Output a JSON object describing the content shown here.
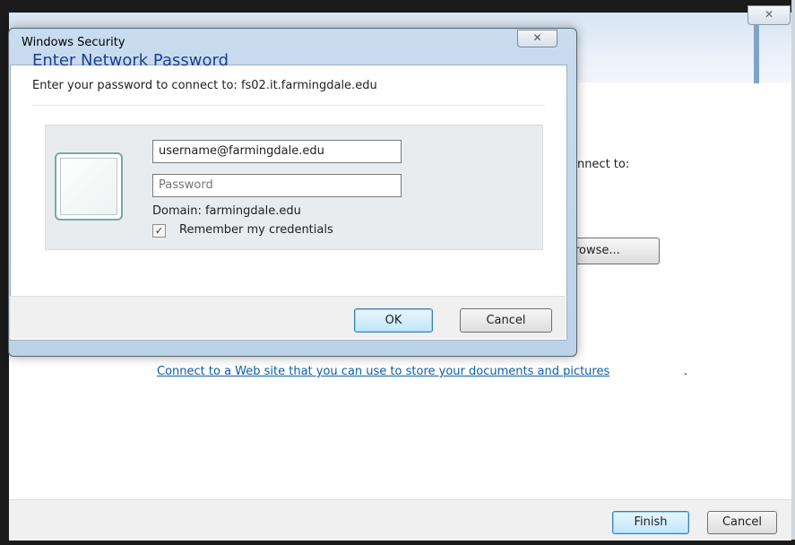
{
  "background_window": {
    "close_glyph": "✕",
    "connect_text": "onnect to:",
    "browse_label": "Browse...",
    "browse_visible": "rowse...",
    "link_text": "Connect to a Web site that you can use to store your documents and pictures",
    "link_period": ".",
    "finish_label": "Finish",
    "cancel_label": "Cancel"
  },
  "dialog": {
    "title": "Windows Security",
    "close_glyph": "✕",
    "heading": "Enter Network Password",
    "subtitle": "Enter your password to connect to: fs02.it.farmingdale.edu",
    "username_value": "username@farmingdale.edu",
    "password_placeholder": "Password",
    "domain_text": "Domain: farmingdale.edu",
    "remember_label": "Remember my credentials",
    "remember_checked": true,
    "check_glyph": "✓",
    "ok_label": "OK",
    "cancel_label": "Cancel"
  },
  "colors": {
    "heading": "#1c3f94",
    "link": "#0d5ea8",
    "default_button_border": "#3c7fb1"
  }
}
